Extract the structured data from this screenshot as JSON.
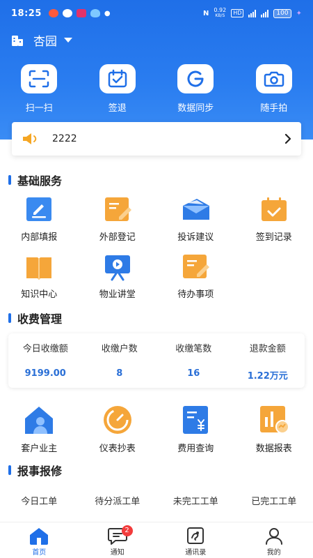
{
  "status_bar": {
    "time": "18:25",
    "network_speed": "0.92",
    "network_unit": "KB/S",
    "hd": "HD",
    "battery": "100"
  },
  "location": {
    "name": "杏园"
  },
  "quick_actions": [
    {
      "label": "扫一扫",
      "icon": "scan-icon"
    },
    {
      "label": "签退",
      "icon": "calendar-check-icon"
    },
    {
      "label": "数据同步",
      "icon": "sync-icon"
    },
    {
      "label": "随手拍",
      "icon": "camera-icon"
    }
  ],
  "notice": {
    "text": "2222"
  },
  "basic_services": {
    "title": "基础服务",
    "items": [
      {
        "label": "内部填报",
        "icon": "edit-form-icon"
      },
      {
        "label": "外部登记",
        "icon": "register-icon"
      },
      {
        "label": "投诉建议",
        "icon": "mail-send-icon"
      },
      {
        "label": "签到记录",
        "icon": "checkin-record-icon"
      },
      {
        "label": "知识中心",
        "icon": "book-icon"
      },
      {
        "label": "物业讲堂",
        "icon": "video-class-icon"
      },
      {
        "label": "待办事项",
        "icon": "todo-icon"
      }
    ]
  },
  "fee_management": {
    "title": "收费管理",
    "stats": [
      {
        "label": "今日收缴额",
        "value": "9199.00"
      },
      {
        "label": "收缴户数",
        "value": "8"
      },
      {
        "label": "收缴笔数",
        "value": "16"
      },
      {
        "label": "退款金额",
        "value": "1.22万元"
      }
    ],
    "items": [
      {
        "label": "套户业主",
        "icon": "house-owner-icon"
      },
      {
        "label": "仪表抄表",
        "icon": "gauge-icon"
      },
      {
        "label": "费用查询",
        "icon": "fee-query-icon"
      },
      {
        "label": "数据报表",
        "icon": "report-chart-icon"
      }
    ]
  },
  "repair": {
    "title": "报事报修",
    "columns": [
      "今日工单",
      "待分派工单",
      "未完工工单",
      "已完工工单"
    ]
  },
  "tabbar": {
    "items": [
      {
        "label": "首页",
        "icon": "home-icon",
        "active": true
      },
      {
        "label": "通知",
        "icon": "message-icon",
        "badge": "2"
      },
      {
        "label": "通讯录",
        "icon": "contacts-icon"
      },
      {
        "label": "我的",
        "icon": "profile-icon"
      }
    ]
  },
  "colors": {
    "primary": "#1f6fe8",
    "accent_orange": "#f5a63a",
    "badge_red": "#f23b3b"
  }
}
